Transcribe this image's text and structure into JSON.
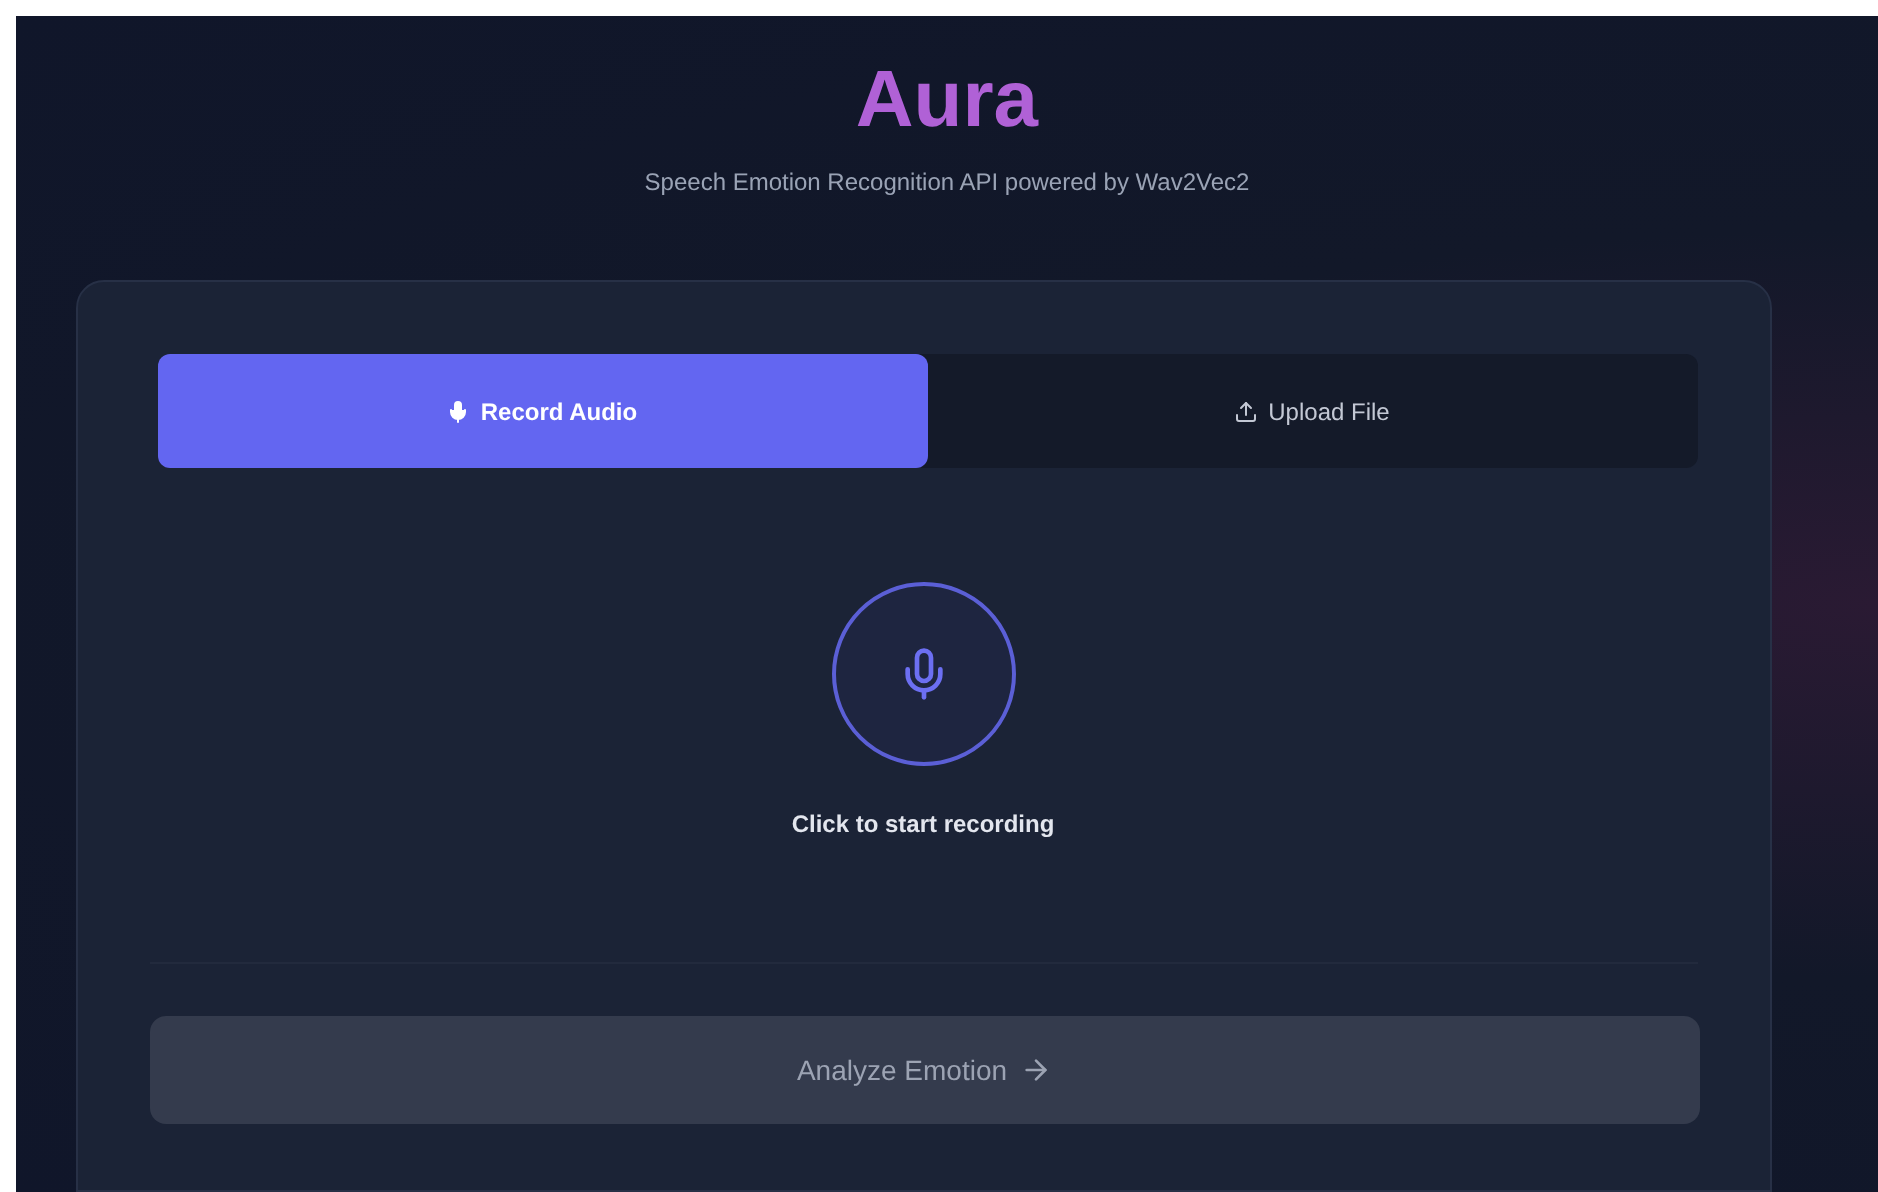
{
  "header": {
    "title": "Aura",
    "subtitle": "Speech Emotion Recognition API powered by Wav2Vec2"
  },
  "tabs": [
    {
      "label": "Record Audio",
      "kind": "record",
      "selected": true
    },
    {
      "label": "Upload File",
      "kind": "upload",
      "selected": false
    }
  ],
  "recorder": {
    "recording": false,
    "hint": "Click to start recording"
  },
  "analyze_button": {
    "label": "Analyze Emotion",
    "disabled": true
  }
}
